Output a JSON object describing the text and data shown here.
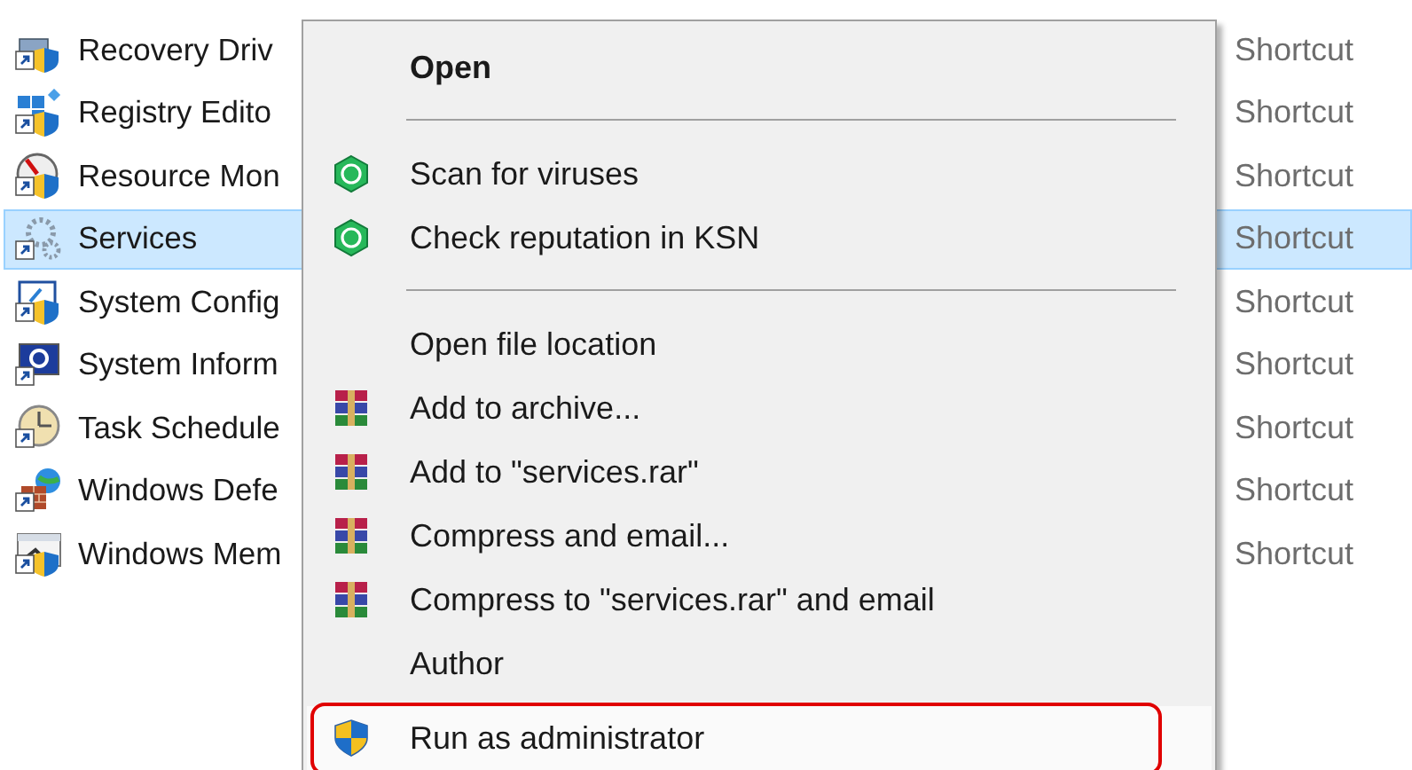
{
  "files": [
    {
      "name": "Recovery Driv",
      "type": "Shortcut",
      "kind": "drive",
      "selected": false
    },
    {
      "name": "Registry Edito",
      "type": "Shortcut",
      "kind": "registry",
      "selected": false
    },
    {
      "name": "Resource Mon",
      "type": "Shortcut",
      "kind": "gauge",
      "selected": false
    },
    {
      "name": "Services",
      "type": "Shortcut",
      "kind": "gears",
      "selected": true
    },
    {
      "name": "System Config",
      "type": "Shortcut",
      "kind": "config",
      "selected": false
    },
    {
      "name": "System Inform",
      "type": "Shortcut",
      "kind": "info",
      "selected": false
    },
    {
      "name": "Task Schedule",
      "type": "Shortcut",
      "kind": "clock",
      "selected": false
    },
    {
      "name": "Windows Defe",
      "type": "Shortcut",
      "kind": "firewall",
      "selected": false
    },
    {
      "name": "Windows Mem",
      "type": "Shortcut",
      "kind": "memory",
      "selected": false
    }
  ],
  "context_menu": [
    {
      "kind": "plain",
      "label": "Open",
      "bold": true,
      "highlighted": false
    },
    {
      "kind": "separator"
    },
    {
      "kind": "antivirus",
      "label": "Scan for viruses",
      "bold": false,
      "highlighted": false
    },
    {
      "kind": "antivirus",
      "label": "Check reputation in KSN",
      "bold": false,
      "highlighted": false
    },
    {
      "kind": "separator"
    },
    {
      "kind": "plain",
      "label": "Open file location",
      "bold": false,
      "highlighted": false
    },
    {
      "kind": "archive",
      "label": "Add to archive...",
      "bold": false,
      "highlighted": false
    },
    {
      "kind": "archive",
      "label": "Add to \"services.rar\"",
      "bold": false,
      "highlighted": false
    },
    {
      "kind": "archive",
      "label": "Compress and email...",
      "bold": false,
      "highlighted": false
    },
    {
      "kind": "archive",
      "label": "Compress to \"services.rar\" and email",
      "bold": false,
      "highlighted": false
    },
    {
      "kind": "plain",
      "label": "Author",
      "bold": false,
      "highlighted": false
    },
    {
      "kind": "shield",
      "label": "Run as administrator",
      "bold": false,
      "highlighted": true
    }
  ]
}
